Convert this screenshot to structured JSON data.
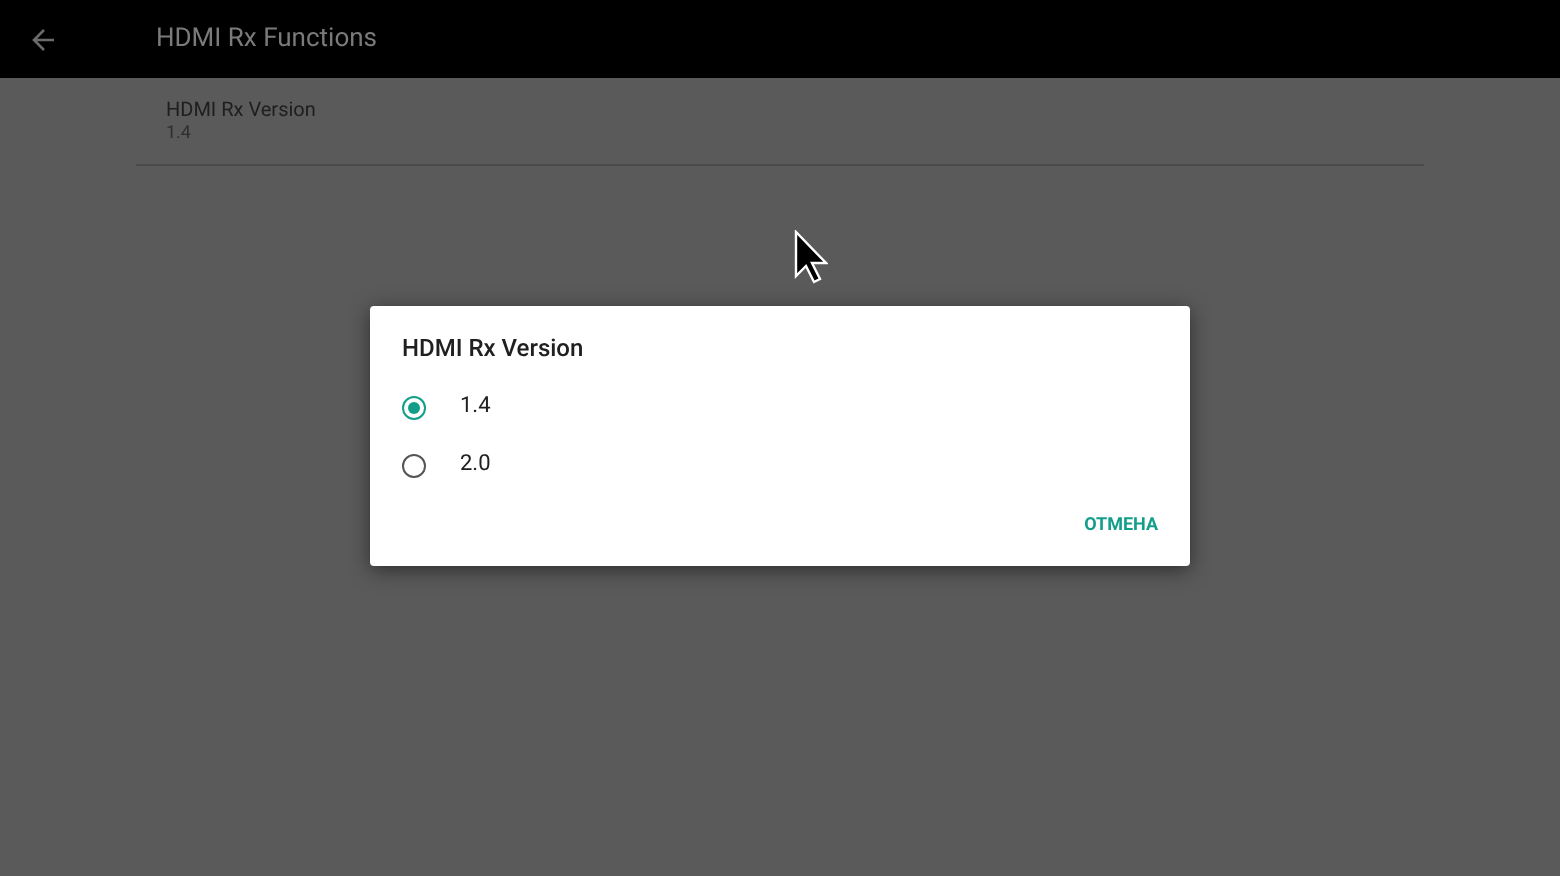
{
  "header": {
    "title": "HDMI Rx Functions"
  },
  "settings": [
    {
      "title": "HDMI Rx Version",
      "value": "1.4"
    }
  ],
  "dialog": {
    "title": "HDMI Rx Version",
    "options": [
      {
        "label": "1.4",
        "selected": true
      },
      {
        "label": "2.0",
        "selected": false
      }
    ],
    "buttons": [
      "ОТМЕНА"
    ]
  }
}
